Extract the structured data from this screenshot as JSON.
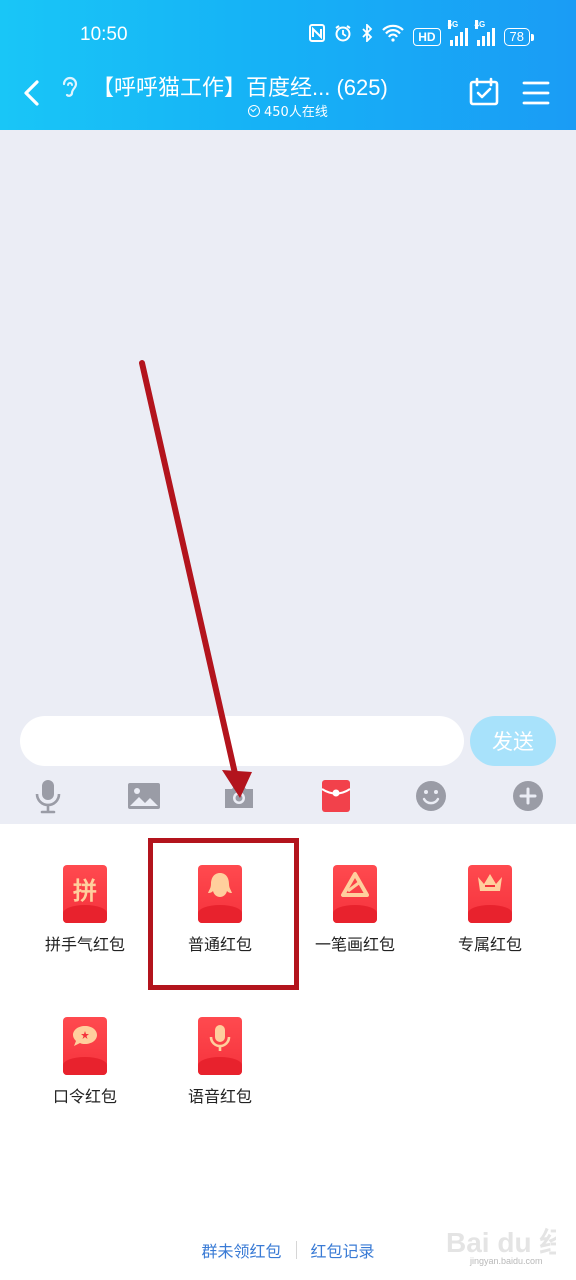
{
  "status": {
    "time": "10:50",
    "hd": "HD",
    "net5g": "5G",
    "net4g": "4G",
    "battery": "78"
  },
  "header": {
    "title": "【呼呼猫工作】百度经... (625)",
    "online": "450人在线"
  },
  "composer": {
    "input_value": "",
    "send_label": "发送"
  },
  "toolbar": {
    "icons": [
      "microphone-icon",
      "image-icon",
      "camera-icon",
      "red-packet-icon",
      "emoji-icon",
      "plus-icon"
    ]
  },
  "red_packets": [
    {
      "label": "拼手气红包",
      "glyph": "拼"
    },
    {
      "label": "普通红包",
      "glyph": ""
    },
    {
      "label": "一笔画红包",
      "glyph": ""
    },
    {
      "label": "专属红包",
      "glyph": ""
    },
    {
      "label": "口令红包",
      "glyph": ""
    },
    {
      "label": "语音红包",
      "glyph": ""
    }
  ],
  "links": {
    "unclaimed": "群未领红包",
    "records": "红包记录"
  },
  "watermark": {
    "text": "Bai du 经验",
    "url": "jingyan.baidu.com"
  },
  "colors": {
    "header_start": "#19c6f7",
    "header_end": "#1a9cf5",
    "red_packet": "#f5323c",
    "annotation": "#b3141d",
    "link": "#3a7bd5"
  }
}
